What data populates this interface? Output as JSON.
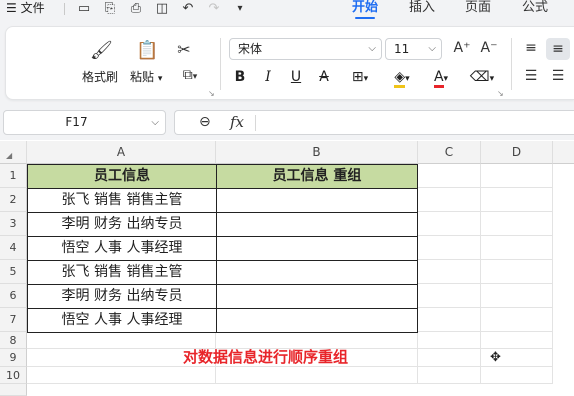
{
  "menubar": {
    "file_label": "文件",
    "tabs": [
      {
        "label": "开始",
        "active": true
      },
      {
        "label": "插入",
        "active": false
      },
      {
        "label": "页面",
        "active": false
      },
      {
        "label": "公式",
        "active": false
      }
    ]
  },
  "ribbon": {
    "format_painter": "格式刷",
    "paste": "粘贴",
    "font_name": "宋体",
    "font_size": "11",
    "bold": "B",
    "italic": "I",
    "underline": "U",
    "strike": "A",
    "font_color": "A"
  },
  "formula_bar": {
    "name_box": "F17",
    "fx": "fx",
    "value": ""
  },
  "grid": {
    "columns": [
      "A",
      "B",
      "C",
      "D"
    ],
    "rows": [
      "1",
      "2",
      "3",
      "4",
      "5",
      "6",
      "7",
      "8",
      "9",
      "10"
    ],
    "header": [
      "员工信息",
      "员工信息 重组"
    ],
    "records": [
      "张飞 销售 销售主管",
      "李明 财务 出纳专员",
      "悟空 人事 人事经理",
      "张飞 销售 销售主管",
      "李明 财务 出纳专员",
      "悟空 人事 人事经理"
    ],
    "note": "对数据信息进行顺序重组"
  },
  "colors": {
    "accent": "#1f6df2",
    "header_fill": "#c6dba1",
    "note": "#e8252a"
  }
}
